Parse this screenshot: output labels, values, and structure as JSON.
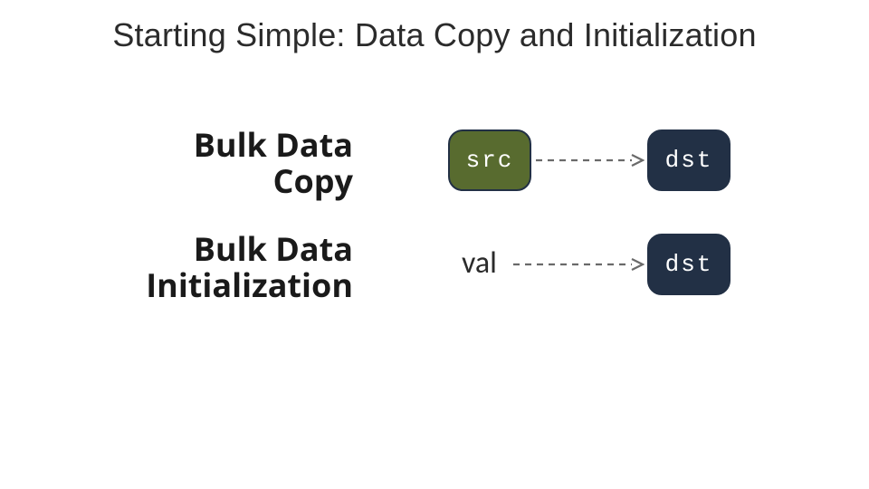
{
  "title": "Starting Simple: Data Copy and Initialization",
  "rows": [
    {
      "label": "Bulk Data\nCopy",
      "source": {
        "text": "src",
        "style": "chip-green"
      },
      "target": {
        "text": "dst",
        "style": "chip-navy"
      }
    },
    {
      "label": "Bulk Data\nInitialization",
      "source": {
        "text": "val",
        "style": "plain"
      },
      "target": {
        "text": "dst",
        "style": "chip-navy"
      }
    }
  ],
  "colors": {
    "chip_green": "#586b2f",
    "chip_navy": "#223045",
    "arrow": "#6a6a6a"
  }
}
